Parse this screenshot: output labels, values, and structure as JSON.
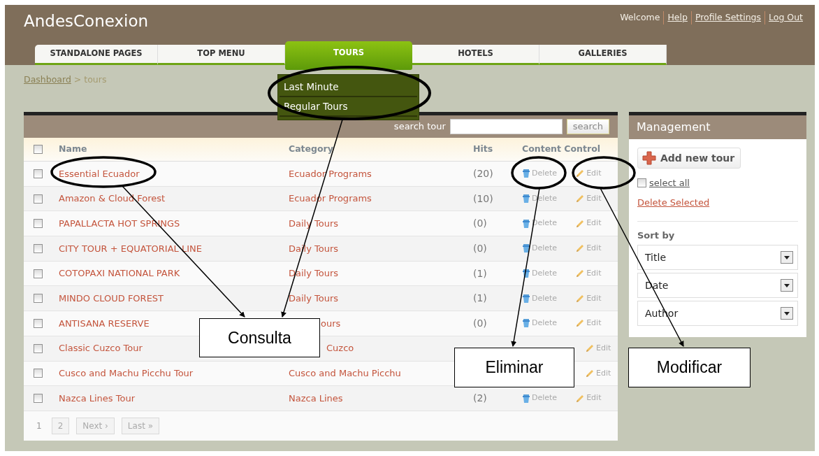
{
  "header": {
    "logo": "AndesConexion",
    "user_links": [
      {
        "text": "Welcome",
        "kind": "text"
      },
      {
        "text": "Help",
        "kind": "link"
      },
      {
        "text": "Profile Settings",
        "kind": "link"
      },
      {
        "text": "Log Out",
        "kind": "link"
      }
    ]
  },
  "tabs": [
    {
      "label": "STANDALONE PAGES",
      "selected": false
    },
    {
      "label": "TOP MENU",
      "selected": false
    },
    {
      "label": "TOURS",
      "selected": true
    },
    {
      "label": "HOTELS",
      "selected": false
    },
    {
      "label": "GALLERIES",
      "selected": false
    }
  ],
  "tab_menu": {
    "items": [
      "Last Minute",
      "Regular Tours"
    ]
  },
  "breadcrumb": {
    "link": "Dashboard",
    "separator": ">",
    "current": "tours"
  },
  "search": {
    "label": "search tour",
    "button": "search"
  },
  "table": {
    "select_all_checked": false,
    "columns": [
      "Name",
      "Category",
      "Hits",
      "Content Control"
    ],
    "rows": [
      {
        "checked": false,
        "name": "Essential Ecuador",
        "category": "Ecuador Programs",
        "hits": "(20)",
        "delete": "Delete",
        "edit": "Edit"
      },
      {
        "checked": false,
        "name": "Amazon & Cloud Forest",
        "category": "Ecuador Programs",
        "hits": "(10)",
        "delete": "Delete",
        "edit": "Edit"
      },
      {
        "checked": false,
        "name": "PAPALLACTA HOT SPRINGS",
        "category": "Daily Tours",
        "hits": "(0)",
        "delete": "Delete",
        "edit": "Edit"
      },
      {
        "checked": false,
        "name": "CITY TOUR + EQUATORIAL LINE",
        "category": "Daily Tours",
        "hits": "(0)",
        "delete": "Delete",
        "edit": "Edit"
      },
      {
        "checked": false,
        "name": "COTOPAXI NATIONAL PARK",
        "category": "Daily Tours",
        "hits": "(1)",
        "delete": "Delete",
        "edit": "Edit"
      },
      {
        "checked": false,
        "name": "MINDO CLOUD FOREST",
        "category": "Daily Tours",
        "hits": "(1)",
        "delete": "Delete",
        "edit": "Edit"
      },
      {
        "checked": false,
        "name": "ANTISANA RESERVE",
        "category_visible_part": "ours",
        "hits": "(0)",
        "delete": "Delete",
        "edit": "Edit"
      },
      {
        "checked": false,
        "name": "Classic Cuzco Tour",
        "category_visible_part": "Cuzco",
        "edit": "Edit"
      },
      {
        "checked": false,
        "name": "Cusco and Machu Picchu Tour",
        "category": "Cusco and Machu Picchu",
        "edit": "Edit"
      },
      {
        "checked": false,
        "name": "Nazca Lines Tour",
        "category": "Nazca Lines",
        "hits": "(2)",
        "delete": "Delete",
        "edit": "Edit"
      }
    ]
  },
  "pagination": [
    {
      "label": "1",
      "selected": true
    },
    {
      "label": "2",
      "selected": false
    },
    {
      "label": "Next ›",
      "selected": false
    },
    {
      "label": "Last »",
      "selected": false
    }
  ],
  "management": {
    "title": "Management",
    "add_button": "Add new tour",
    "select_all": {
      "label": "select all",
      "checked": false
    },
    "delete_selected": "Delete Selected",
    "sort_label": "Sort by",
    "sort_fields": [
      "Title",
      "Date",
      "Author"
    ]
  },
  "annotations": [
    {
      "text": "Consulta"
    },
    {
      "text": "Eliminar"
    },
    {
      "text": "Modificar"
    }
  ]
}
